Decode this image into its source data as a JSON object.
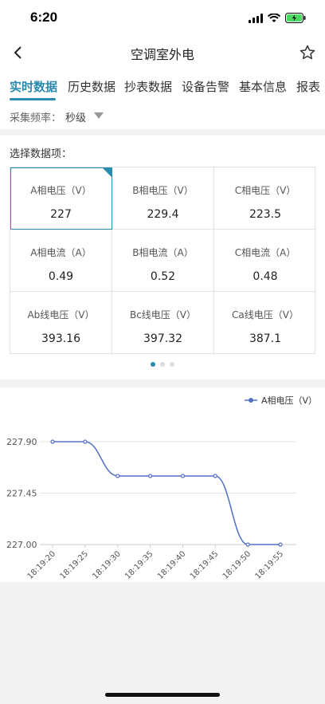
{
  "status": {
    "time": "6:20"
  },
  "nav": {
    "title": "空调室外电"
  },
  "tabs": [
    {
      "label": "实时数据",
      "active": true
    },
    {
      "label": "历史数据",
      "active": false
    },
    {
      "label": "抄表数据",
      "active": false
    },
    {
      "label": "设备告警",
      "active": false
    },
    {
      "label": "基本信息",
      "active": false
    },
    {
      "label": "报表",
      "active": false
    }
  ],
  "frequency": {
    "label": "采集频率：",
    "value": "秒级"
  },
  "data_items": {
    "label": "选择数据项：",
    "cells": [
      {
        "label": "A相电压（V）",
        "value": "227",
        "selected": true
      },
      {
        "label": "B相电压（V）",
        "value": "229.4"
      },
      {
        "label": "C相电压（V）",
        "value": "223.5"
      },
      {
        "label": "A相电流（A）",
        "value": "0.49"
      },
      {
        "label": "B相电流（A）",
        "value": "0.52"
      },
      {
        "label": "C相电流（A）",
        "value": "0.48"
      },
      {
        "label": "Ab线电压（V）",
        "value": "393.16"
      },
      {
        "label": "Bc线电压（V）",
        "value": "397.32"
      },
      {
        "label": "Ca线电压（V）",
        "value": "387.1"
      }
    ],
    "page_dots": {
      "count": 3,
      "active_index": 0
    }
  },
  "chart_data": {
    "type": "line",
    "legend": "A相电压（V）",
    "legend_position": "top-right",
    "color": "#5470c6",
    "x": [
      "18:19:20",
      "18:19:25",
      "18:19:30",
      "18:19:35",
      "18:19:40",
      "18:19:45",
      "18:19:50",
      "18:19:55"
    ],
    "series": [
      {
        "name": "A相电压（V）",
        "values": [
          227.9,
          227.9,
          227.6,
          227.6,
          227.6,
          227.6,
          227.0,
          227.0
        ]
      }
    ],
    "yticks": [
      "227.90",
      "227.45",
      "227.00"
    ],
    "ylim": [
      227.0,
      227.9
    ],
    "grid": true
  }
}
